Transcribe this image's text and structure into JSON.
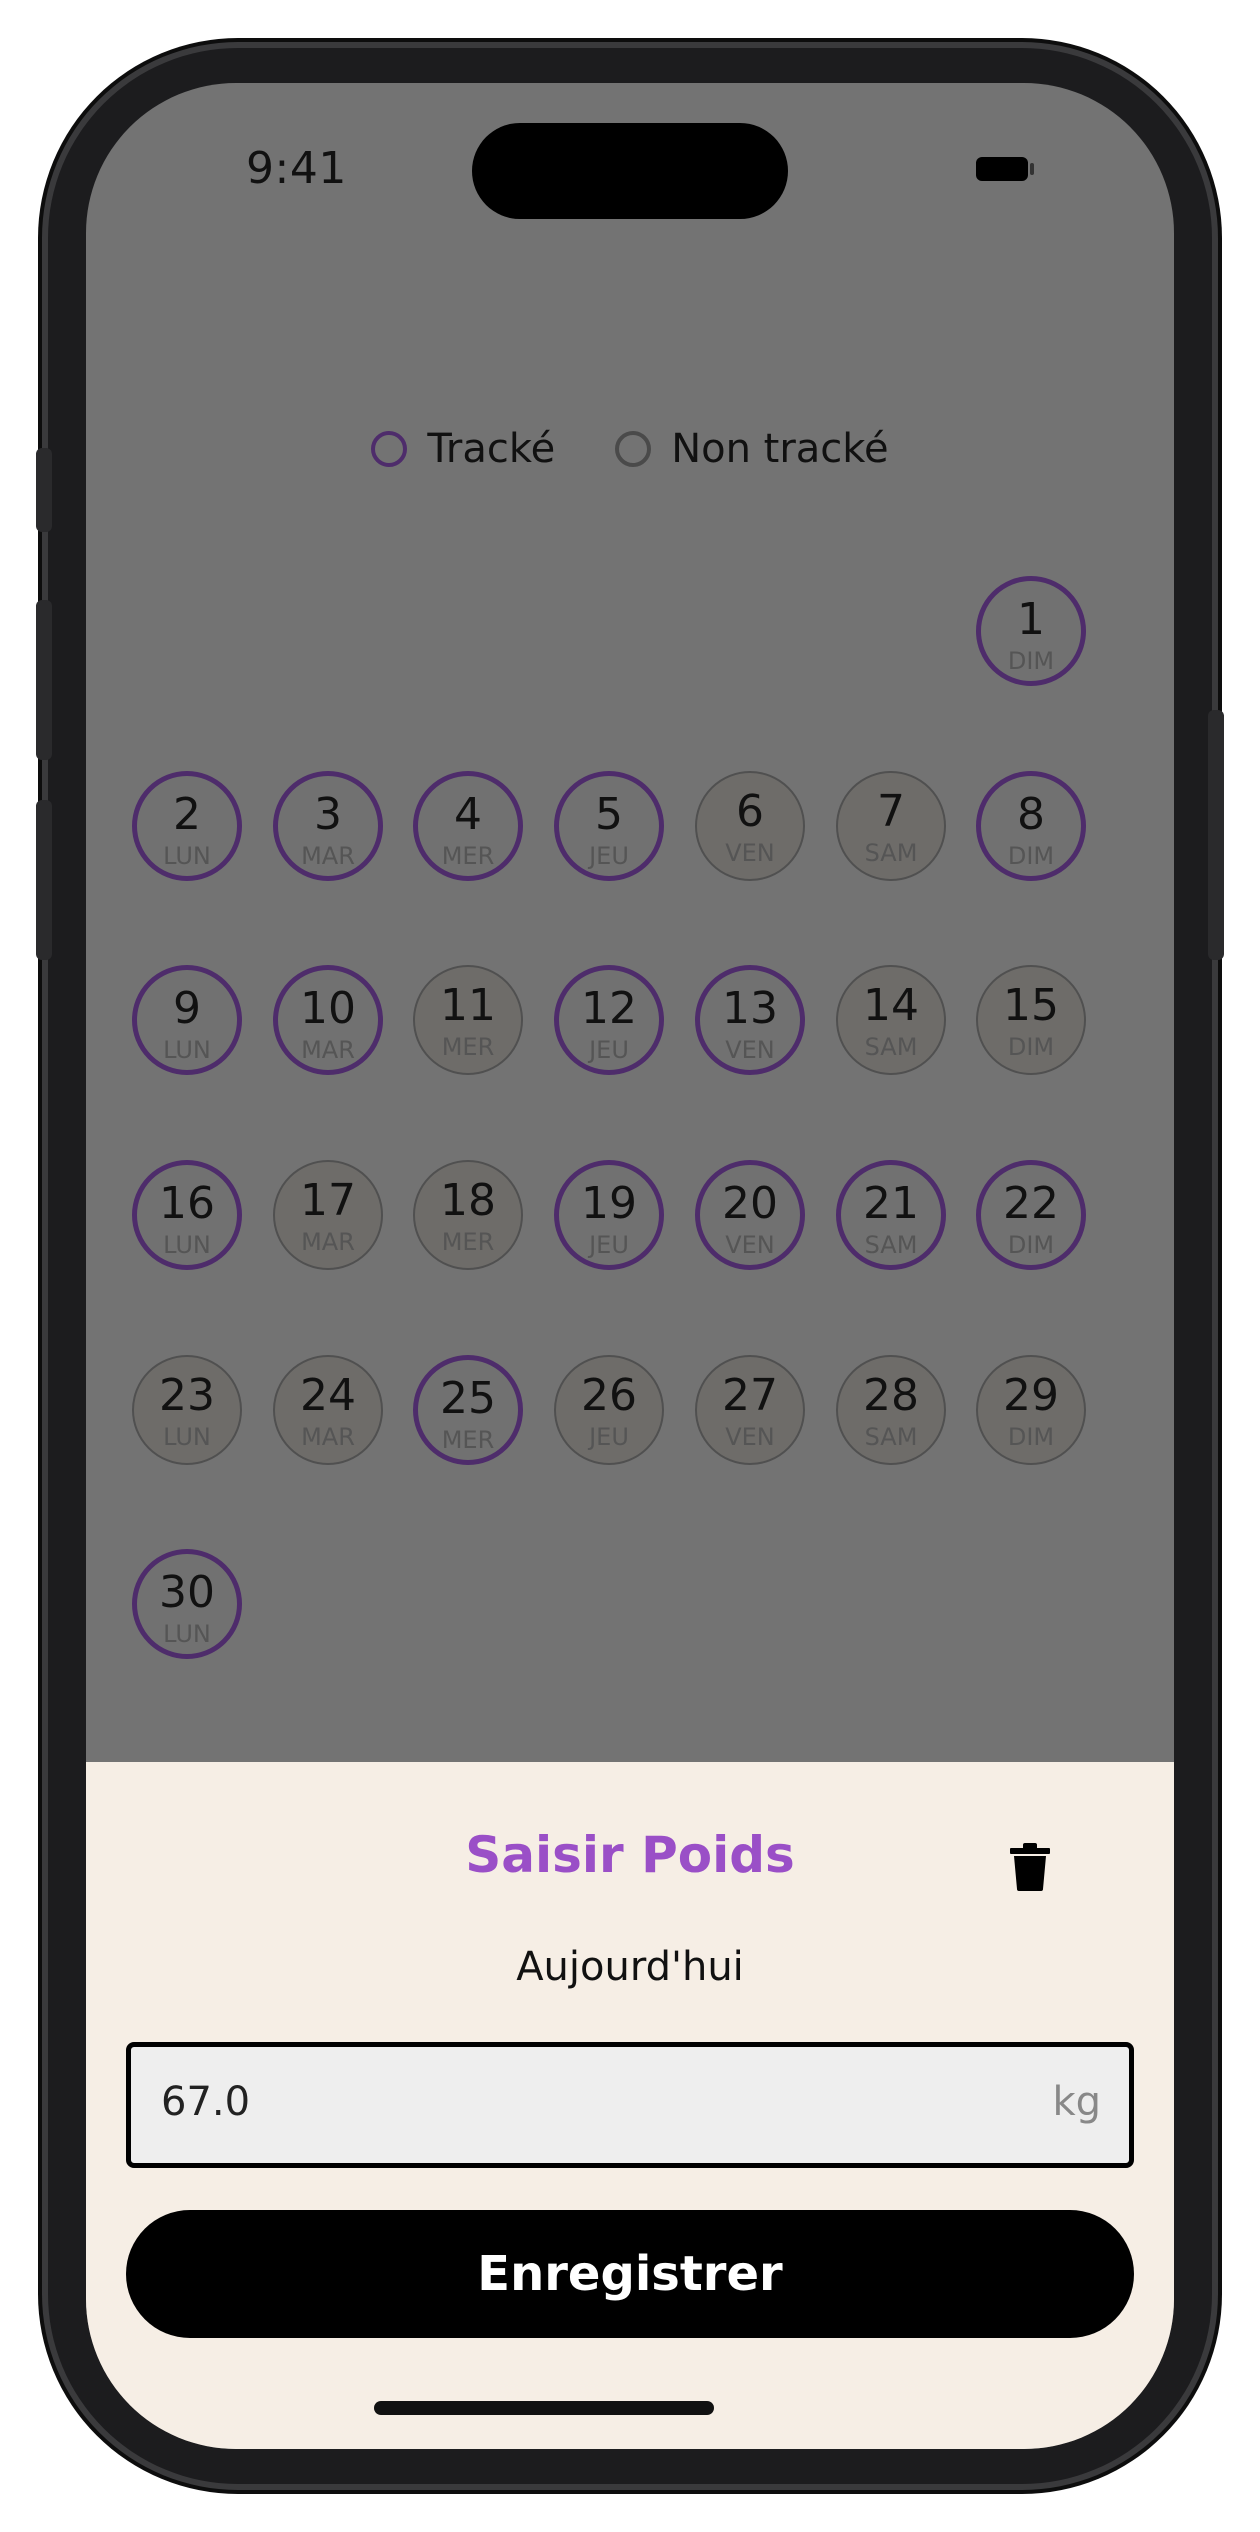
{
  "status_bar": {
    "time": "9:41"
  },
  "legend": {
    "tracked": "Tracké",
    "untracked": "Non tracké"
  },
  "calendar": {
    "days": [
      {
        "day": "1",
        "label": "DIM",
        "tracked": true
      },
      {
        "day": "2",
        "label": "LUN",
        "tracked": true
      },
      {
        "day": "3",
        "label": "MAR",
        "tracked": true
      },
      {
        "day": "4",
        "label": "MER",
        "tracked": true
      },
      {
        "day": "5",
        "label": "JEU",
        "tracked": true
      },
      {
        "day": "6",
        "label": "VEN",
        "tracked": false
      },
      {
        "day": "7",
        "label": "SAM",
        "tracked": false
      },
      {
        "day": "8",
        "label": "DIM",
        "tracked": true
      },
      {
        "day": "9",
        "label": "LUN",
        "tracked": true
      },
      {
        "day": "10",
        "label": "MAR",
        "tracked": true
      },
      {
        "day": "11",
        "label": "MER",
        "tracked": false
      },
      {
        "day": "12",
        "label": "JEU",
        "tracked": true
      },
      {
        "day": "13",
        "label": "VEN",
        "tracked": true
      },
      {
        "day": "14",
        "label": "SAM",
        "tracked": false
      },
      {
        "day": "15",
        "label": "DIM",
        "tracked": false
      },
      {
        "day": "16",
        "label": "LUN",
        "tracked": true
      },
      {
        "day": "17",
        "label": "MAR",
        "tracked": false
      },
      {
        "day": "18",
        "label": "MER",
        "tracked": false
      },
      {
        "day": "19",
        "label": "JEU",
        "tracked": true
      },
      {
        "day": "20",
        "label": "VEN",
        "tracked": true
      },
      {
        "day": "21",
        "label": "SAM",
        "tracked": true
      },
      {
        "day": "22",
        "label": "DIM",
        "tracked": true
      },
      {
        "day": "23",
        "label": "LUN",
        "tracked": false
      },
      {
        "day": "24",
        "label": "MAR",
        "tracked": false
      },
      {
        "day": "25",
        "label": "MER",
        "tracked": true
      },
      {
        "day": "26",
        "label": "JEU",
        "tracked": false
      },
      {
        "day": "27",
        "label": "VEN",
        "tracked": false
      },
      {
        "day": "28",
        "label": "SAM",
        "tracked": false
      },
      {
        "day": "29",
        "label": "DIM",
        "tracked": false
      },
      {
        "day": "30",
        "label": "LUN",
        "tracked": true
      }
    ]
  },
  "sheet": {
    "title": "Saisir Poids",
    "date_label": "Aujourd'hui",
    "weight_value": "67.0",
    "weight_unit": "kg",
    "save_label": "Enregistrer",
    "delete_icon": "trash-icon"
  },
  "colors": {
    "accent": "#9a4fc7",
    "tracked_ring": "#4e2c6b",
    "sheet_background": "#f6eee5",
    "overlay": "#737373"
  }
}
